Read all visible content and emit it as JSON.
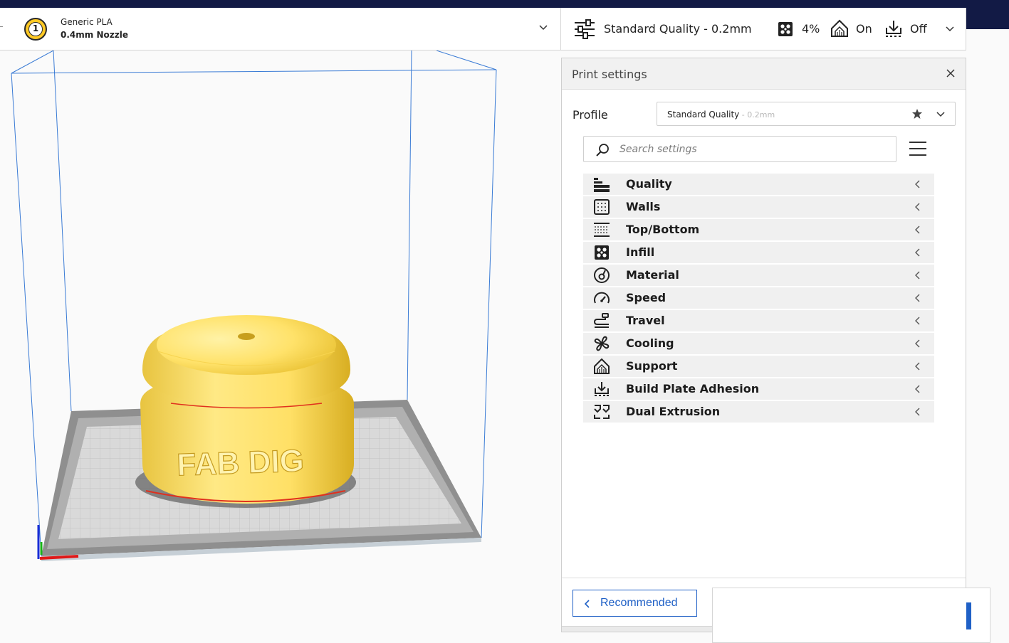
{
  "extruder": {
    "number": "1",
    "material": "Generic PLA",
    "nozzle": "0.4mm Nozzle",
    "badge_color": "#ffc924"
  },
  "summary": {
    "profile": "Standard Quality - 0.2mm",
    "infill": "4%",
    "support": "On",
    "adhesion": "Off",
    "icons": [
      "sliders-icon",
      "infill-icon",
      "support-icon",
      "adhesion-icon",
      "chevron-down-icon"
    ]
  },
  "panel": {
    "title": "Print settings",
    "profile_label": "Profile",
    "profile_name": "Standard Quality",
    "profile_sub": " - 0.2mm",
    "search_placeholder": "Search settings",
    "categories": [
      {
        "label": "Quality",
        "icon": "quality-icon"
      },
      {
        "label": "Walls",
        "icon": "walls-icon"
      },
      {
        "label": "Top/Bottom",
        "icon": "top-bottom-icon"
      },
      {
        "label": "Infill",
        "icon": "infill-icon"
      },
      {
        "label": "Material",
        "icon": "material-icon"
      },
      {
        "label": "Speed",
        "icon": "speed-icon"
      },
      {
        "label": "Travel",
        "icon": "travel-icon"
      },
      {
        "label": "Cooling",
        "icon": "fan-icon"
      },
      {
        "label": "Support",
        "icon": "support-icon"
      },
      {
        "label": "Build Plate Adhesion",
        "icon": "adhesion-icon"
      },
      {
        "label": "Dual Extrusion",
        "icon": "dual-extrusion-icon"
      }
    ],
    "recommended_label": "Recommended"
  },
  "model": {
    "text": "FAB DIG",
    "color": "#ffe26a"
  },
  "colors": {
    "accent": "#1f60c6",
    "topbar": "#121a45"
  }
}
